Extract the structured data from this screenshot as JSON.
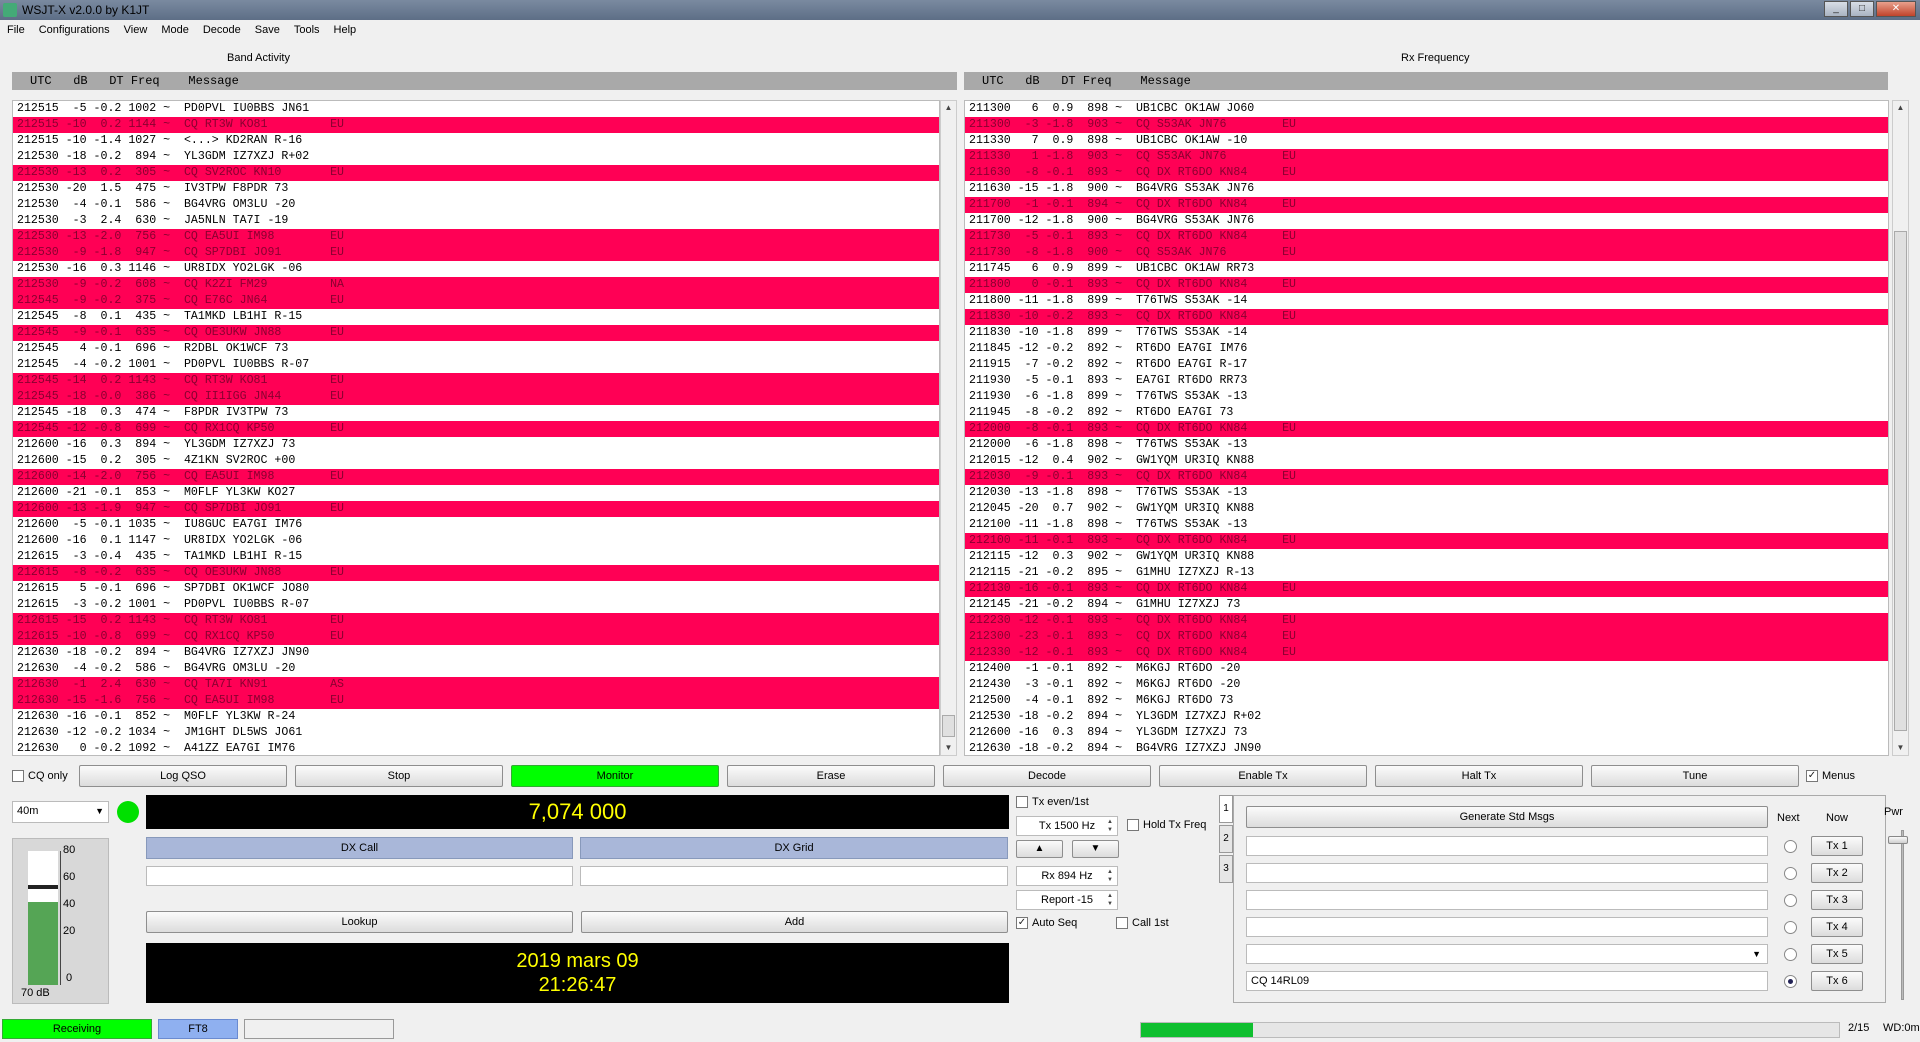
{
  "window": {
    "title": "WSJT-X   v2.0.0   by K1JT",
    "min": "_",
    "max": "□",
    "close": "✕"
  },
  "menu": [
    "File",
    "Configurations",
    "View",
    "Mode",
    "Decode",
    "Save",
    "Tools",
    "Help"
  ],
  "band_activity": {
    "title": "Band Activity",
    "header": "UTC   dB   DT Freq    Message",
    "rows": [
      {
        "t": "212515  -5 -0.2 1002 ~  PD0PVL IU0BBS JN61",
        "cq": false
      },
      {
        "t": "212515 -10  0.2 1144 ~  CQ RT3W KO81         EU",
        "cq": true
      },
      {
        "t": "212515 -10 -1.4 1027 ~  <...> KD2RAN R-16",
        "cq": false
      },
      {
        "t": "212530 -18 -0.2  894 ~  YL3GDM IZ7XZJ R+02",
        "cq": false
      },
      {
        "t": "212530 -13  0.2  305 ~  CQ SV2ROC KN10       EU",
        "cq": true
      },
      {
        "t": "212530 -20  1.5  475 ~  IV3TPW F8PDR 73",
        "cq": false
      },
      {
        "t": "212530  -4 -0.1  586 ~  BG4VRG OM3LU -20",
        "cq": false
      },
      {
        "t": "212530  -3  2.4  630 ~  JA5NLN TA7I -19",
        "cq": false
      },
      {
        "t": "212530 -13 -2.0  756 ~  CQ EA5UI IM98        EU",
        "cq": true
      },
      {
        "t": "212530  -9 -1.8  947 ~  CQ SP7DBI JO91       EU",
        "cq": true
      },
      {
        "t": "212530 -16  0.3 1146 ~  UR8IDX YO2LGK -06",
        "cq": false
      },
      {
        "t": "212530  -9 -0.2  608 ~  CQ K2ZI FM29         NA",
        "cq": true
      },
      {
        "t": "212545  -9 -0.2  375 ~  CQ E76C JN64         EU",
        "cq": true
      },
      {
        "t": "212545  -8  0.1  435 ~  TA1MKD LB1HI R-15",
        "cq": false
      },
      {
        "t": "212545  -9 -0.1  635 ~  CQ OE3UKW JN88       EU",
        "cq": true
      },
      {
        "t": "212545   4 -0.1  696 ~  R2DBL OK1WCF 73",
        "cq": false
      },
      {
        "t": "212545  -4 -0.2 1001 ~  PD0PVL IU0BBS R-07",
        "cq": false
      },
      {
        "t": "212545 -14  0.2 1143 ~  CQ RT3W KO81         EU",
        "cq": true
      },
      {
        "t": "212545 -18 -0.0  386 ~  CQ II1IGG JN44       EU",
        "cq": true
      },
      {
        "t": "212545 -18  0.3  474 ~  F8PDR IV3TPW 73",
        "cq": false
      },
      {
        "t": "212545 -12 -0.8  699 ~  CQ RX1CQ KP50        EU",
        "cq": true
      },
      {
        "t": "212600 -16  0.3  894 ~  YL3GDM IZ7XZJ 73",
        "cq": false
      },
      {
        "t": "212600 -15  0.2  305 ~  4Z1KN SV2ROC +00",
        "cq": false
      },
      {
        "t": "212600 -14 -2.0  756 ~  CQ EA5UI IM98        EU",
        "cq": true
      },
      {
        "t": "212600 -21 -0.1  853 ~  M0FLF YL3KW KO27",
        "cq": false
      },
      {
        "t": "212600 -13 -1.9  947 ~  CQ SP7DBI JO91       EU",
        "cq": true
      },
      {
        "t": "212600  -5 -0.1 1035 ~  IU8GUC EA7GI IM76",
        "cq": false
      },
      {
        "t": "212600 -16  0.1 1147 ~  UR8IDX YO2LGK -06",
        "cq": false
      },
      {
        "t": "212615  -3 -0.4  435 ~  TA1MKD LB1HI R-15",
        "cq": false
      },
      {
        "t": "212615  -8 -0.2  635 ~  CQ OE3UKW JN88       EU",
        "cq": true
      },
      {
        "t": "212615   5 -0.1  696 ~  SP7DBI OK1WCF JO80",
        "cq": false
      },
      {
        "t": "212615  -3 -0.2 1001 ~  PD0PVL IU0BBS R-07",
        "cq": false
      },
      {
        "t": "212615 -15  0.2 1143 ~  CQ RT3W KO81         EU",
        "cq": true
      },
      {
        "t": "212615 -10 -0.8  699 ~  CQ RX1CQ KP50        EU",
        "cq": true
      },
      {
        "t": "212630 -18 -0.2  894 ~  BG4VRG IZ7XZJ JN90",
        "cq": false
      },
      {
        "t": "212630  -4 -0.2  586 ~  BG4VRG OM3LU -20",
        "cq": false
      },
      {
        "t": "212630  -1  2.4  630 ~  CQ TA7I KN91         AS",
        "cq": true
      },
      {
        "t": "212630 -15 -1.6  756 ~  CQ EA5UI IM98        EU",
        "cq": true
      },
      {
        "t": "212630 -16 -0.1  852 ~  M0FLF YL3KW R-24",
        "cq": false
      },
      {
        "t": "212630 -12 -0.2 1034 ~  JM1GHT DL5WS JO61",
        "cq": false
      },
      {
        "t": "212630   0 -0.2 1092 ~  A41ZZ EA7GI IM76",
        "cq": false
      }
    ]
  },
  "rx_frequency": {
    "title": "Rx Frequency",
    "header": "UTC   dB   DT Freq    Message",
    "rows": [
      {
        "t": "211300   6  0.9  898 ~  UB1CBC OK1AW JO60",
        "cq": false
      },
      {
        "t": "211300  -3 -1.8  903 ~  CQ S53AK JN76        EU",
        "cq": true
      },
      {
        "t": "211330   7  0.9  898 ~  UB1CBC OK1AW -10",
        "cq": false
      },
      {
        "t": "211330   1 -1.8  903 ~  CQ S53AK JN76        EU",
        "cq": true
      },
      {
        "t": "211630  -8 -0.1  893 ~  CQ DX RT6DO KN84     EU",
        "cq": true
      },
      {
        "t": "211630 -15 -1.8  900 ~  BG4VRG S53AK JN76",
        "cq": false
      },
      {
        "t": "211700  -1 -0.1  894 ~  CQ DX RT6DO KN84     EU",
        "cq": true
      },
      {
        "t": "211700 -12 -1.8  900 ~  BG4VRG S53AK JN76",
        "cq": false
      },
      {
        "t": "211730  -5 -0.1  893 ~  CQ DX RT6DO KN84     EU",
        "cq": true
      },
      {
        "t": "211730  -8 -1.8  900 ~  CQ S53AK JN76        EU",
        "cq": true
      },
      {
        "t": "211745   6  0.9  899 ~  UB1CBC OK1AW RR73",
        "cq": false
      },
      {
        "t": "211800   0 -0.1  893 ~  CQ DX RT6DO KN84     EU",
        "cq": true
      },
      {
        "t": "211800 -11 -1.8  899 ~  T76TWS S53AK -14",
        "cq": false
      },
      {
        "t": "211830 -10 -0.2  893 ~  CQ DX RT6DO KN84     EU",
        "cq": true
      },
      {
        "t": "211830 -10 -1.8  899 ~  T76TWS S53AK -14",
        "cq": false
      },
      {
        "t": "211845 -12 -0.2  892 ~  RT6DO EA7GI IM76",
        "cq": false
      },
      {
        "t": "211915  -7 -0.2  892 ~  RT6DO EA7GI R-17",
        "cq": false
      },
      {
        "t": "211930  -5 -0.1  893 ~  EA7GI RT6DO RR73",
        "cq": false
      },
      {
        "t": "211930  -6 -1.8  899 ~  T76TWS S53AK -13",
        "cq": false
      },
      {
        "t": "211945  -8 -0.2  892 ~  RT6DO EA7GI 73",
        "cq": false
      },
      {
        "t": "212000  -8 -0.1  893 ~  CQ DX RT6DO KN84     EU",
        "cq": true
      },
      {
        "t": "212000  -6 -1.8  898 ~  T76TWS S53AK -13",
        "cq": false
      },
      {
        "t": "212015 -12  0.4  902 ~  GW1YQM UR3IQ KN88",
        "cq": false
      },
      {
        "t": "212030  -9 -0.1  893 ~  CQ DX RT6DO KN84     EU",
        "cq": true
      },
      {
        "t": "212030 -13 -1.8  898 ~  T76TWS S53AK -13",
        "cq": false
      },
      {
        "t": "212045 -20  0.7  902 ~  GW1YQM UR3IQ KN88",
        "cq": false
      },
      {
        "t": "212100 -11 -1.8  898 ~  T76TWS S53AK -13",
        "cq": false
      },
      {
        "t": "212100 -11 -0.1  893 ~  CQ DX RT6DO KN84     EU",
        "cq": true
      },
      {
        "t": "212115 -12  0.3  902 ~  GW1YQM UR3IQ KN88",
        "cq": false
      },
      {
        "t": "212115 -21 -0.2  895 ~  G1MHU IZ7XZJ R-13",
        "cq": false
      },
      {
        "t": "212130 -16 -0.1  893 ~  CQ DX RT6DO KN84     EU",
        "cq": true
      },
      {
        "t": "212145 -21 -0.2  894 ~  G1MHU IZ7XZJ 73",
        "cq": false
      },
      {
        "t": "212230 -12 -0.1  893 ~  CQ DX RT6DO KN84     EU",
        "cq": true
      },
      {
        "t": "212300 -23 -0.1  893 ~  CQ DX RT6DO KN84     EU",
        "cq": true
      },
      {
        "t": "212330 -12 -0.1  893 ~  CQ DX RT6DO KN84     EU",
        "cq": true
      },
      {
        "t": "212400  -1 -0.1  892 ~  M6KGJ RT6DO -20",
        "cq": false
      },
      {
        "t": "212430  -3 -0.1  892 ~  M6KGJ RT6DO -20",
        "cq": false
      },
      {
        "t": "212500  -4 -0.1  892 ~  M6KGJ RT6DO 73",
        "cq": false
      },
      {
        "t": "212530 -18 -0.2  894 ~  YL3GDM IZ7XZJ R+02",
        "cq": false
      },
      {
        "t": "212600 -16  0.3  894 ~  YL3GDM IZ7XZJ 73",
        "cq": false
      },
      {
        "t": "212630 -18 -0.2  894 ~  BG4VRG IZ7XZJ JN90",
        "cq": false
      }
    ]
  },
  "controls": {
    "cq_only": "CQ only",
    "log_qso": "Log QSO",
    "stop": "Stop",
    "monitor": "Monitor",
    "erase": "Erase",
    "decode": "Decode",
    "enable_tx": "Enable Tx",
    "halt_tx": "Halt Tx",
    "tune": "Tune",
    "menus": "Menus"
  },
  "band": "40m",
  "frequency": "7,074 000",
  "dx_call_label": "DX Call",
  "dx_grid_label": "DX Grid",
  "lookup": "Lookup",
  "add": "Add",
  "date": "2019 mars 09",
  "time": "21:26:47",
  "meter": {
    "ticks": [
      "80",
      "60",
      "40",
      "20",
      "0"
    ],
    "level_label": "70 dB",
    "level_fraction": 0.62
  },
  "tx_settings": {
    "tx_even": "Tx even/1st",
    "tx_hz": "Tx  1500  Hz",
    "hold_tx_freq": "Hold Tx Freq",
    "up": "▲",
    "down": "▼",
    "rx_hz": "Rx  894  Hz",
    "report": "Report -15",
    "auto_seq": "Auto Seq",
    "call_1st": "Call 1st"
  },
  "tabs": [
    "1",
    "2",
    "3"
  ],
  "messages": {
    "generate": "Generate Std Msgs",
    "next": "Next",
    "now": "Now",
    "pwr": "Pwr",
    "tx": [
      "Tx 1",
      "Tx 2",
      "Tx 3",
      "Tx 4",
      "Tx 5",
      "Tx 6"
    ],
    "tx6_text": "CQ 14RL09"
  },
  "statusbar": {
    "receiving": "Receiving",
    "mode": "FT8",
    "progress_fraction": 0.16,
    "period": "2/15",
    "wd": "WD:0m"
  },
  "colors": {
    "cq_highlight": "#ff0055",
    "monitor_on": "#00ff00",
    "lcd_text": "#ffff00"
  }
}
